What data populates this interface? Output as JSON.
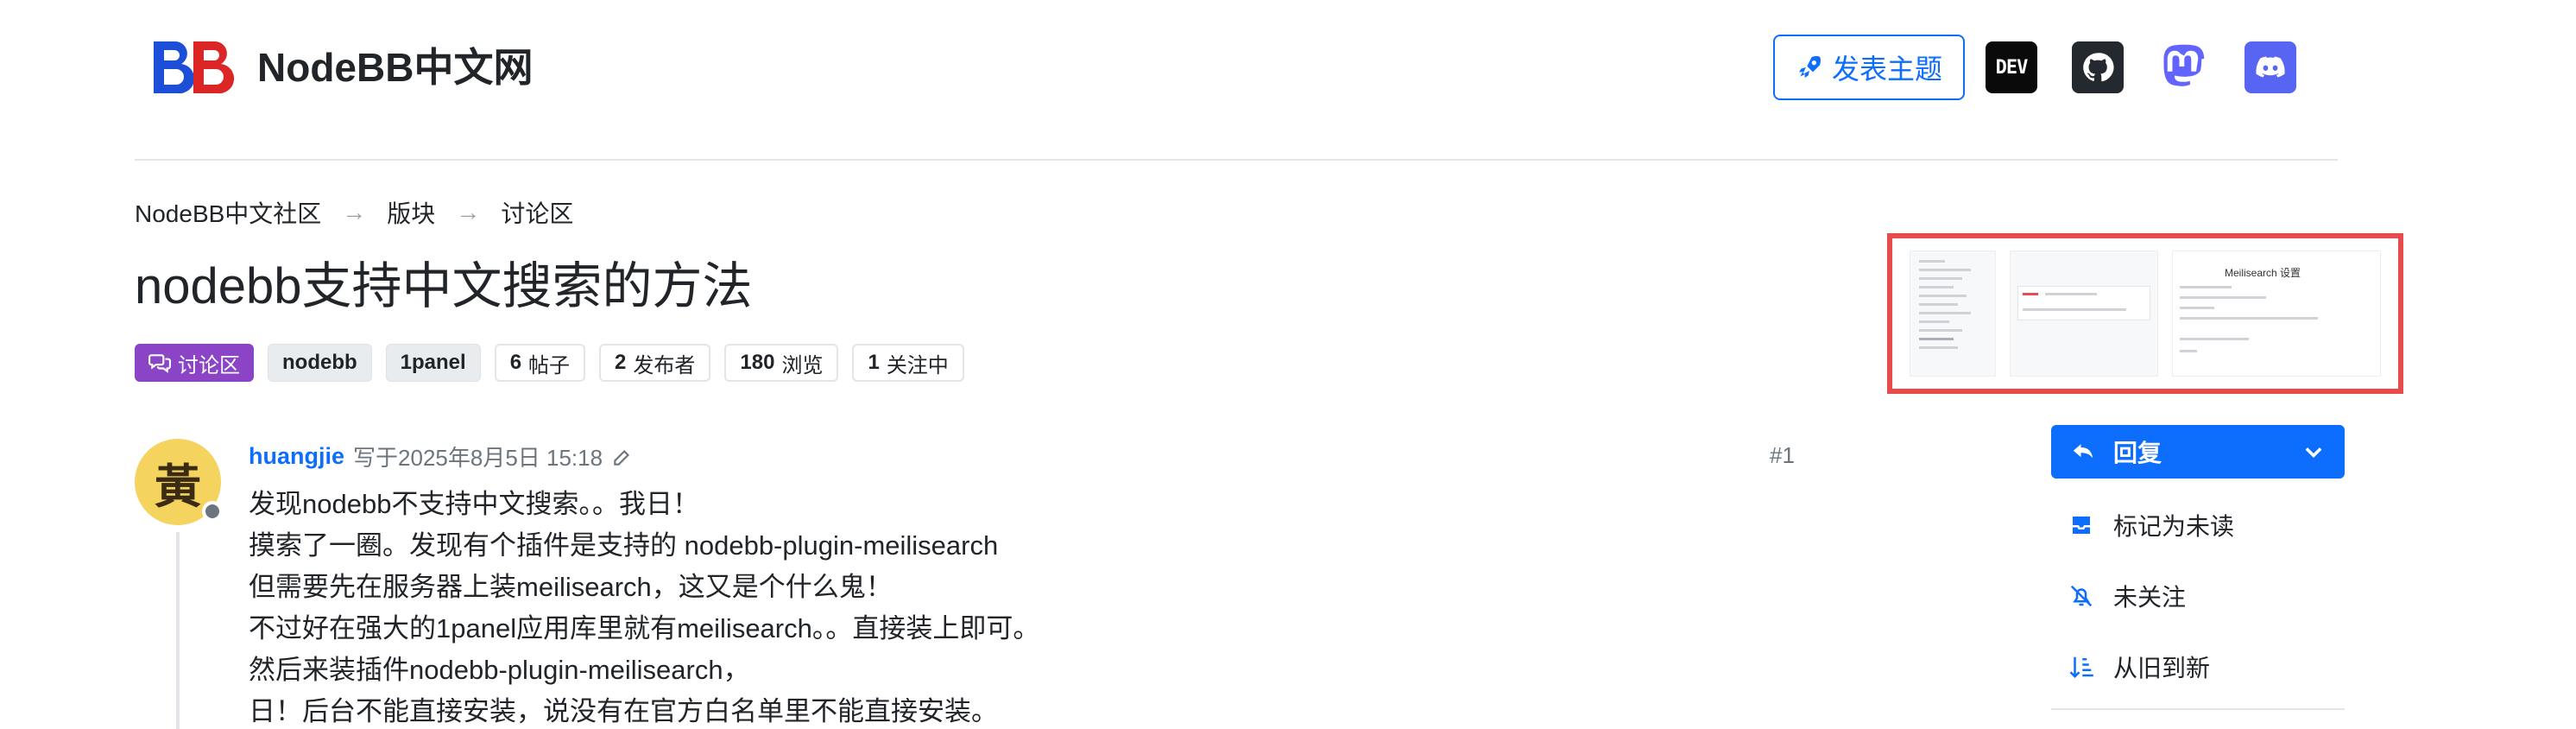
{
  "header": {
    "brand": "NodeBB中文网",
    "post_topic_label": "发表主题",
    "dev_label": "DEV",
    "colors": {
      "primary": "#0d6efd",
      "logo_blue": "#1d4ed8",
      "logo_red": "#dc2626",
      "discord": "#5865f2",
      "mastodon": "#6364ff"
    }
  },
  "breadcrumb": [
    "NodeBB中文社区",
    "版块",
    "讨论区"
  ],
  "topic": {
    "title": "nodebb支持中文搜索的方法",
    "category": "讨论区",
    "tags": [
      "nodebb",
      "1panel"
    ],
    "stats": {
      "posts_count": "6",
      "posts_label": "帖子",
      "posters_count": "2",
      "posters_label": "发布者",
      "views_count": "180",
      "views_label": "浏览",
      "following_count": "1",
      "following_label": "关注中"
    }
  },
  "thumbnail": {
    "shot_title": "Meilisearch 设置"
  },
  "post": {
    "avatar_char": "黃",
    "author": "huangjie",
    "wrote_label": "写于",
    "timestamp": "2025年8月5日 15:18",
    "index": "#1",
    "lines": [
      "发现nodebb不支持中文搜索。。我日！",
      "摸索了一圈。发现有个插件是支持的 nodebb-plugin-meilisearch",
      "但需要先在服务器上装meilisearch，这又是个什么鬼！",
      "不过好在强大的1panel应用库里就有meilisearch。。直接装上即可。",
      "然后来装插件nodebb-plugin-meilisearch，",
      "日！后台不能直接安装，说没有在官方白名单里不能直接安装。"
    ]
  },
  "actions": {
    "reply_label": "回复",
    "mark_unread_label": "标记为未读",
    "not_watching_label": "未关注",
    "sort_label": "从旧到新"
  }
}
